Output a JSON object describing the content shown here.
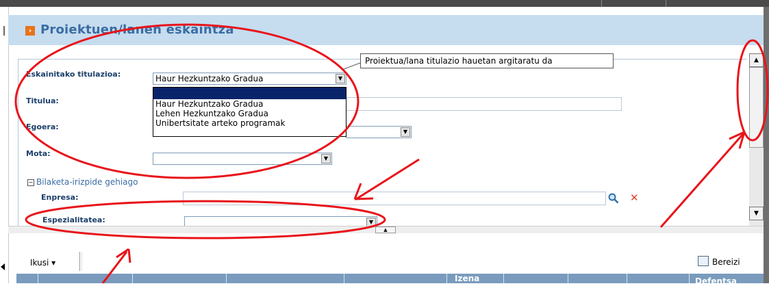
{
  "header": {
    "title": "Proiektuen/lanen eskaintza",
    "icon": "orange-arrow-icon"
  },
  "tooltip": {
    "text": "Proiektua/lana titulazio hauetan argitaratu da"
  },
  "form": {
    "titulazioa": {
      "label": "Eskainitako titulazioa:",
      "value": "Haur Hezkuntzako Gradua",
      "options": [
        "",
        "Haur Hezkuntzako Gradua",
        "Lehen Hezkuntzako Gradua",
        "Unibertsitate arteko programak"
      ]
    },
    "titulua": {
      "label": "Titulua:",
      "value": ""
    },
    "egoera": {
      "label": "Egoera:",
      "value": ""
    },
    "mota": {
      "label": "Mota:",
      "value": ""
    },
    "more_criteria": {
      "label": "Bilaketa-irizpide gehiago"
    },
    "enpresa": {
      "label": "Enpresa:",
      "value": ""
    },
    "espezialitatea": {
      "label": "Espezialitatea:",
      "value": ""
    }
  },
  "toolbar": {
    "ikusi_label": "Ikusi",
    "bereizi_label": "Bereizi"
  },
  "grid": {
    "columns": [
      "Izena",
      "Defentsa"
    ]
  },
  "colors": {
    "header_bg": "#c6dcef",
    "title": "#3a6da3",
    "label": "#1c3f6b",
    "annotation_red": "#e8141a",
    "grid_header": "#7a9bbd"
  }
}
